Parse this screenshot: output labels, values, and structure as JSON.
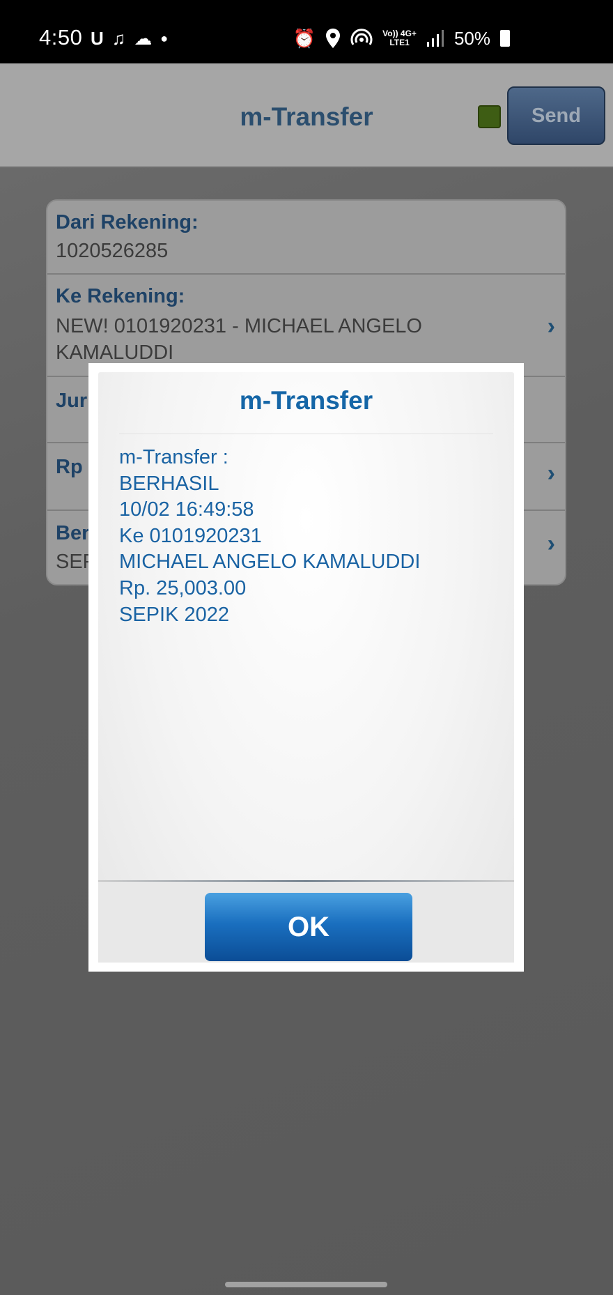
{
  "status_bar": {
    "time": "4:50",
    "battery": "50%",
    "network_top": "Vo)) 4G+",
    "network_bottom": "LTE1",
    "left_icons": [
      "u-icon",
      "tiktok-icon",
      "cloud-icon",
      "dot-icon"
    ],
    "right_icons": [
      "alarm-icon",
      "location-icon",
      "hotspot-icon",
      "signal-icon",
      "battery-icon"
    ]
  },
  "header": {
    "title": "m-Transfer",
    "send_label": "Send",
    "status_color": "#5aa01c"
  },
  "form": {
    "rows": [
      {
        "label": "Dari Rekening:",
        "value": "1020526285"
      },
      {
        "label": "Ke Rekening:",
        "value": "NEW! 0101920231 - MICHAEL ANGELO KAMALUDDI"
      },
      {
        "label": "Jur",
        "value": ""
      },
      {
        "label": "Rp",
        "value": ""
      },
      {
        "label": "Ber",
        "value": "SEP"
      }
    ]
  },
  "dialog": {
    "title": "m-Transfer",
    "lines": [
      "m-Transfer :",
      "BERHASIL",
      "10/02 16:49:58",
      "Ke 0101920231",
      "MICHAEL ANGELO KAMALUDDI",
      "Rp. 25,003.00",
      "SEPIK 2022"
    ],
    "ok_label": "OK"
  },
  "colors": {
    "accent": "#1566a7",
    "ok_button": "#1a6fbf"
  }
}
